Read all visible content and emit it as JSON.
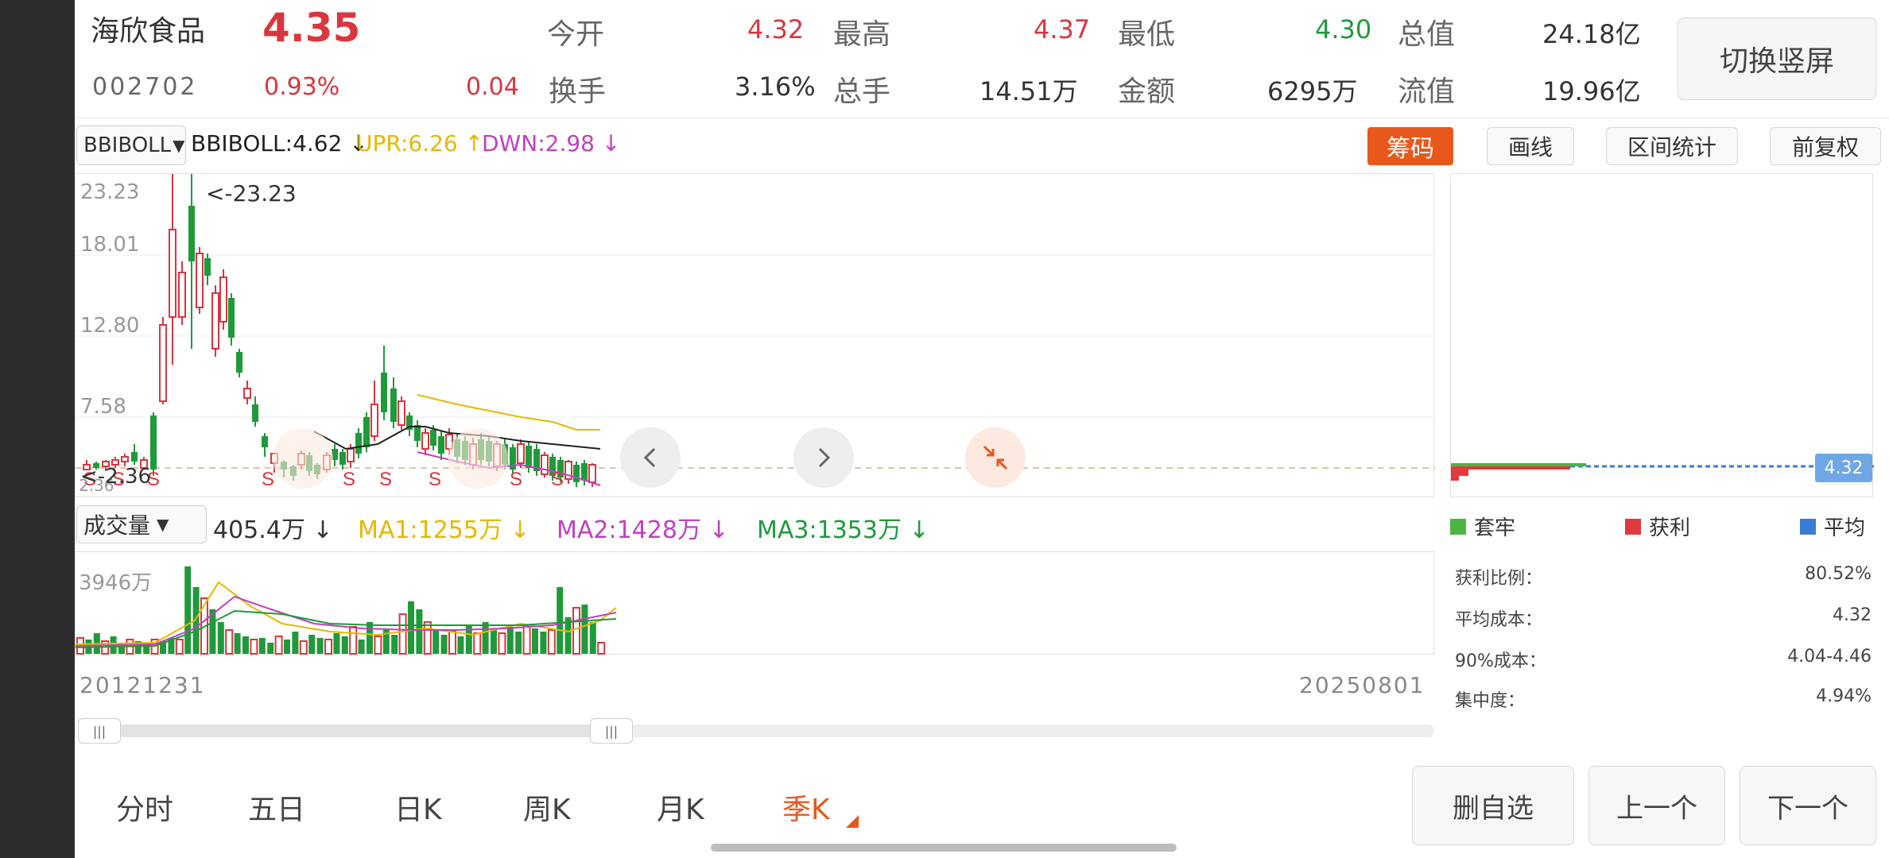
{
  "stock": {
    "name": "海欣食品",
    "price": "4.35",
    "code": "002702",
    "change_pct": "0.93%",
    "change_amt": "0.04"
  },
  "quote": {
    "open_label": "今开",
    "open_val": "4.32",
    "high_label": "最高",
    "high_val": "4.37",
    "low_label": "最低",
    "low_val": "4.30",
    "mktcap_label": "总值",
    "mktcap_val": "24.18亿",
    "turnover_label": "换手",
    "turnover_val": "3.16%",
    "volume_label": "总手",
    "volume_val": "14.51万",
    "amount_label": "金额",
    "amount_val": "6295万",
    "float_label": "流值",
    "float_val": "19.96亿"
  },
  "switch_button": "切换竖屏",
  "toolbar": {
    "indicator_select": "BBIBOLL",
    "bbi_text": "BBIBOLL:4.62 ↓",
    "upr_text": "UPR:6.26 ↑",
    "dwn_text": "DWN:2.98 ↓",
    "chip_button": "筹码",
    "draw_button": "画线",
    "range_button": "区间统计",
    "adjust_button": "前复权"
  },
  "price_chart": {
    "y_labels": [
      "23.23",
      "18.01",
      "12.80",
      "7.58",
      "2.36"
    ],
    "max_annotation": "<-23.23",
    "min_annotation": "<-2.36",
    "current_price_tag": "4.32",
    "s_marker": "S"
  },
  "volume": {
    "select_label": "成交量",
    "vol_text": "405.4万 ↓",
    "ma1_text": "MA1:1255万 ↓",
    "ma2_text": "MA2:1428万 ↓",
    "ma3_text": "MA3:1353万 ↓",
    "max_label": "3946万"
  },
  "dates": {
    "start": "20121231",
    "end": "20250801"
  },
  "chips": {
    "legend": [
      {
        "label": "套牢",
        "color": "#4bb543"
      },
      {
        "label": "获利",
        "color": "#e0393e"
      },
      {
        "label": "平均",
        "color": "#3a7bd5"
      }
    ],
    "stats": [
      {
        "label": "获利比例：",
        "value": "80.52%"
      },
      {
        "label": "平均成本：",
        "value": "4.32"
      },
      {
        "label": "90%成本：",
        "value": "4.04-4.46"
      },
      {
        "label": "集中度：",
        "value": "4.94%"
      }
    ]
  },
  "period_tabs": [
    "分时",
    "五日",
    "日K",
    "周K",
    "月K",
    "季K"
  ],
  "active_tab": "季K",
  "bottom_buttons": {
    "delete": "删自选",
    "prev": "上一个",
    "next": "下一个"
  },
  "colors": {
    "up": "#d9363e",
    "down": "#1f9a3a",
    "accent": "#e8581c",
    "bbi": "#222222",
    "upr": "#e6b800",
    "dwn": "#c040c0"
  }
}
